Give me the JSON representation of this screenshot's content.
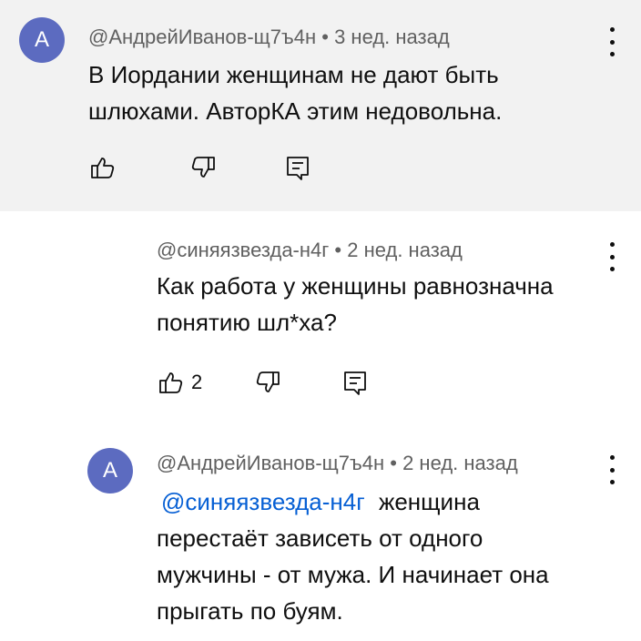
{
  "comments": [
    {
      "avatar_letter": "A",
      "author": "@АндрейИванов-щ7ъ4н",
      "separator": "•",
      "time": "3 нед. назад",
      "lines": [
        "В Иордании женщинам не дают быть",
        "шлюхами. АвторКА этим недовольна."
      ],
      "like_count": ""
    },
    {
      "author": "@синяязвезда-н4г",
      "separator": "•",
      "time": "2 нед. назад",
      "lines": [
        "Как работа у женщины равнозначна",
        "понятию шл*ха?"
      ],
      "like_count": "2"
    },
    {
      "avatar_letter": "A",
      "author": "@АндрейИванов-щ7ъ4н",
      "separator": "•",
      "time": "2 нед. назад",
      "mention": "@синяязвезда-н4г",
      "first_line_rest": "женщина",
      "lines": [
        "перестаёт зависеть от одного",
        "мужчины - от мужа. И начинает она",
        "прыгать по буям."
      ]
    }
  ],
  "colors": {
    "highlight_bg": "#f2f2f2",
    "avatar": "#5c6bc0",
    "mention": "#065fd4",
    "meta": "#606060"
  },
  "icons": [
    "thumb-up-icon",
    "thumb-down-icon",
    "reply-icon",
    "more-vert-icon"
  ]
}
